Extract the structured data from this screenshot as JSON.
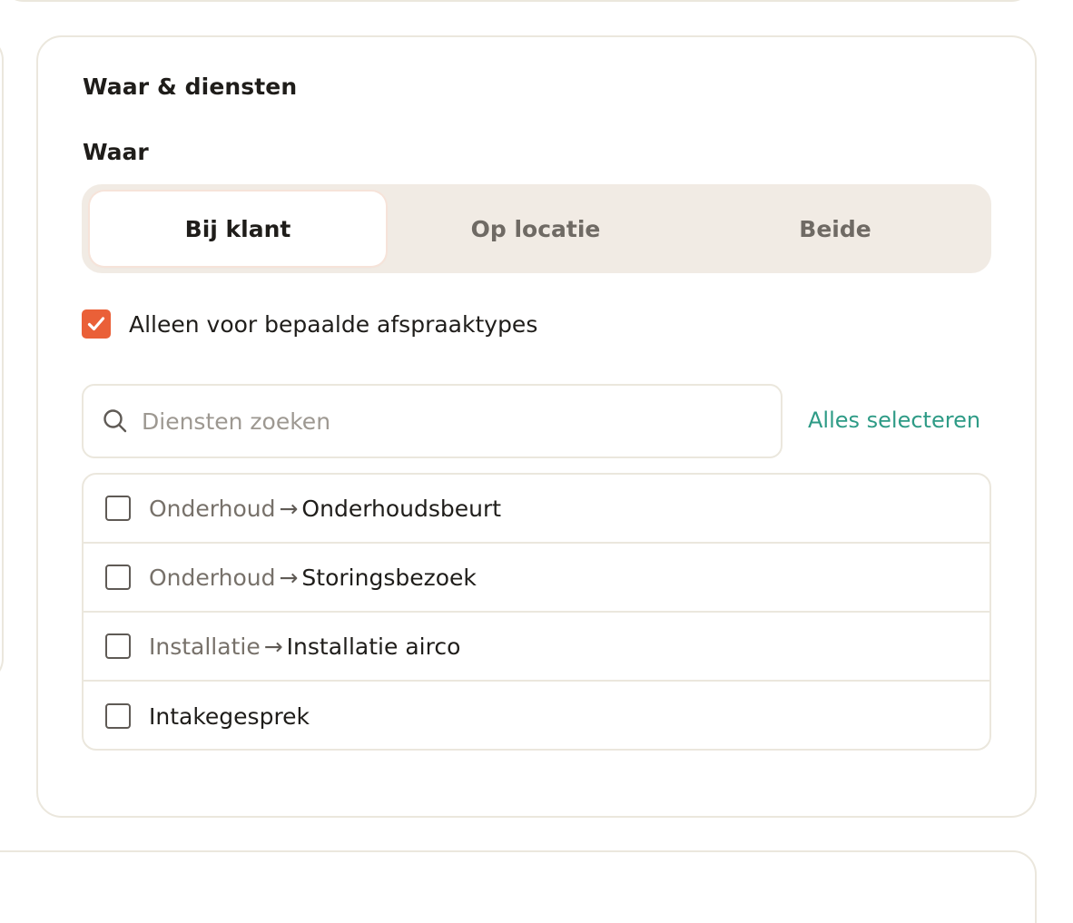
{
  "card": {
    "title": "Waar & diensten",
    "where_label": "Waar"
  },
  "location_options": [
    {
      "label": "Bij klant",
      "selected": true
    },
    {
      "label": "Op locatie",
      "selected": false
    },
    {
      "label": "Beide",
      "selected": false
    }
  ],
  "restrict_checkbox": {
    "label": "Alleen voor bepaalde afspraaktypes",
    "checked": true
  },
  "search": {
    "placeholder": "Diensten zoeken",
    "value": ""
  },
  "select_all_label": "Alles selecteren",
  "services": [
    {
      "category": "Onderhoud",
      "arrow": "→",
      "name": "Onderhoudsbeurt",
      "checked": false
    },
    {
      "category": "Onderhoud",
      "arrow": "→",
      "name": "Storingsbezoek",
      "checked": false
    },
    {
      "category": "Installatie",
      "arrow": "→",
      "name": "Installatie airco",
      "checked": false
    },
    {
      "category": "",
      "arrow": "",
      "name": "Intakegesprek",
      "checked": false
    }
  ],
  "colors": {
    "accent": "#ea6038",
    "link": "#2e9b86",
    "border": "#ebe7dd",
    "segment_bg": "#f1ebe4"
  }
}
